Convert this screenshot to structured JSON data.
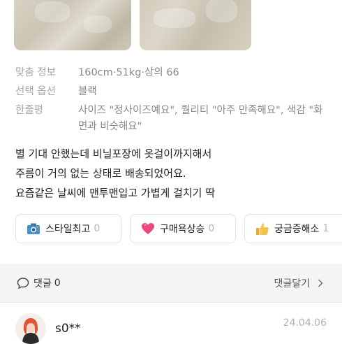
{
  "review": {
    "fit_info": {
      "label": "맞춤 정보",
      "value": "160cm·51kg·상의 66"
    },
    "option": {
      "label": "선택 옵션",
      "value": "블랙"
    },
    "summary": {
      "label": "한줄평",
      "value": "사이즈 \"정사이즈예요\", 퀄리티 \"아주 만족해요\", 색감 \"화면과 비슷해요\""
    },
    "body_lines": [
      "별 기대 안했는데 비닐포장에 옷걸이까지해서",
      "주름이 거의 없는 상태로 배송되었어요.",
      "요즘같은 날씨에 맨투맨입고 가볍게 걸치기 딱"
    ],
    "reactions": [
      {
        "icon": "camera-icon",
        "label": "스타일최고",
        "count": "0"
      },
      {
        "icon": "heart-icon",
        "label": "구매욕상승",
        "count": "0"
      },
      {
        "icon": "thumbs-up-icon",
        "label": "궁금증해소",
        "count": "1"
      }
    ]
  },
  "comments": {
    "label": "댓글",
    "count": "0",
    "write_label": "댓글달기"
  },
  "next_review": {
    "username": "s0**",
    "date": "24.04.06"
  }
}
